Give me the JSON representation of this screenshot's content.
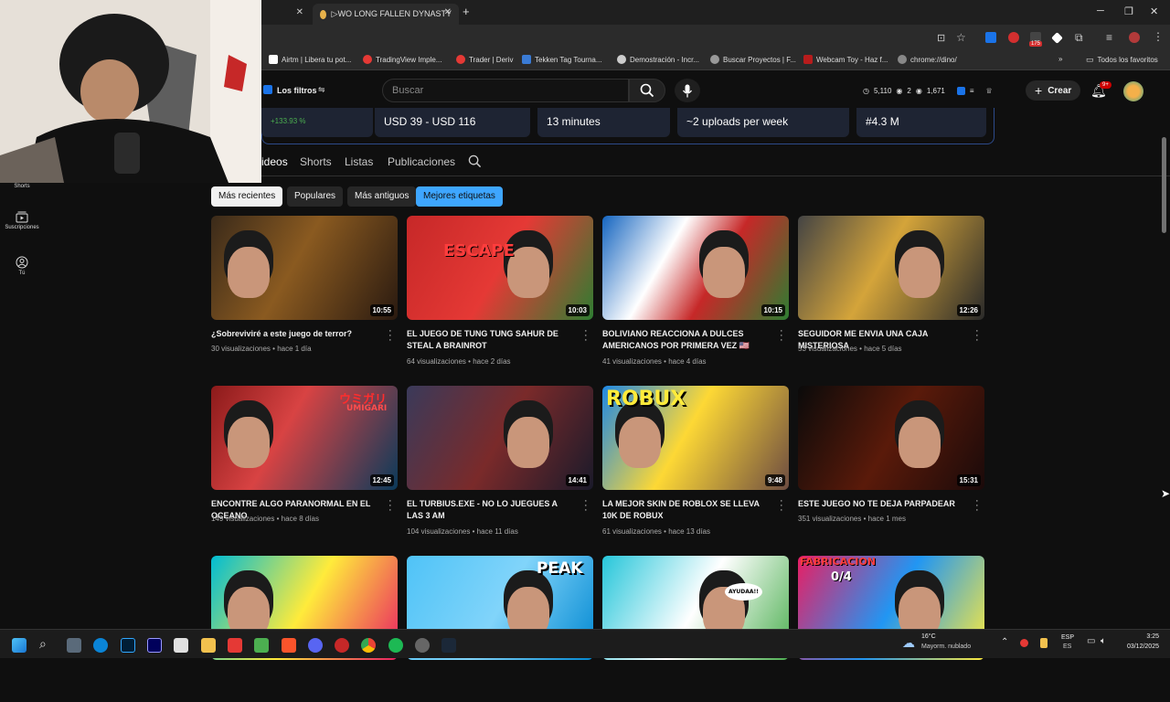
{
  "browser": {
    "tabs": [
      {
        "label": ""
      },
      {
        "label": "▷WO LONG FALLEN DYNASTY"
      }
    ],
    "new_tab": "+",
    "window_controls": [
      "─",
      "❐",
      "✕"
    ],
    "bookmarks": [
      {
        "label": "Airtm | Libera tu pot...",
        "color": "#ffffff"
      },
      {
        "label": "TradingView Imple...",
        "color": "#e53935"
      },
      {
        "label": "Trader | Deriv",
        "color": "#e53935"
      },
      {
        "label": "Tekken Tag Tourna...",
        "color": "#3a7bd5"
      },
      {
        "label": "Demostración - Incr...",
        "color": "#cccccc"
      },
      {
        "label": "Buscar Proyectos | F...",
        "color": "#cccccc"
      },
      {
        "label": "Webcam Toy - Haz f...",
        "color": "#b71c1c"
      },
      {
        "label": "chrome://dino/",
        "color": "#aaaaaa"
      }
    ],
    "all_favorites": "Todos los favoritos",
    "ext_badge": "175"
  },
  "yt": {
    "filters_label": "Los filtros",
    "search_placeholder": "Buscar",
    "stats": {
      "a": "5,110",
      "b": "2",
      "c": "1,671"
    },
    "create_label": "Crear",
    "notif_badge": "9+",
    "stat_cards": [
      {
        "label": "+133.93 %"
      },
      {
        "label": "USD 39 - USD 116"
      },
      {
        "label": "13 minutes"
      },
      {
        "label": "~2 uploads per week"
      },
      {
        "label": "#4.3 M"
      }
    ],
    "channel_tabs": [
      "ideos",
      "Shorts",
      "Listas",
      "Publicaciones"
    ],
    "chips": [
      "Más recientes",
      "Populares",
      "Más antiguos",
      "Mejores etiquetas"
    ],
    "sidebar": [
      {
        "label": "Shorts"
      },
      {
        "label": "Suscripciones"
      },
      {
        "label": "Tú"
      }
    ]
  },
  "videos": [
    {
      "title": "¿Sobreviviré a este juego de terror?",
      "views": "30 visualizaciones",
      "age": "hace 1 día",
      "duration": "10:55"
    },
    {
      "title": "EL JUEGO DE TUNG TUNG SAHUR DE STEAL A BRAINROT",
      "views": "64 visualizaciones",
      "age": "hace 2 días",
      "duration": "10:03",
      "overlay": "ESCAPE"
    },
    {
      "title": "BOLIVIANO REACCIONA A DULCES AMERICANOS POR PRIMERA VEZ 🇺🇸",
      "views": "41 visualizaciones",
      "age": "hace 4 días",
      "duration": "10:15"
    },
    {
      "title": "SEGUIDOR ME ENVIA UNA CAJA MISTERIOSA",
      "views": "53 visualizaciones",
      "age": "hace 5 días",
      "duration": "12:26"
    },
    {
      "title": "ENCONTRE ALGO PARANORMAL EN EL OCEANO",
      "views": "149 visualizaciones",
      "age": "hace 8 días",
      "duration": "12:45",
      "overlay": "ウミガリ",
      "overlay2": "UMIGARI"
    },
    {
      "title": "EL TURBIUS.EXE - NO LO JUEGUES A LAS 3 AM",
      "views": "104 visualizaciones",
      "age": "hace 11 días",
      "duration": "14:41"
    },
    {
      "title": "LA MEJOR SKIN DE ROBLOX SE LLEVA 10K DE ROBUX",
      "views": "61 visualizaciones",
      "age": "hace 13 días",
      "duration": "9:48",
      "overlay": "ROBUX"
    },
    {
      "title": "ESTE JUEGO NO TE DEJA PARPADEAR",
      "views": "351 visualizaciones",
      "age": "hace 1 mes",
      "duration": "15:31"
    },
    {
      "title": "",
      "views": "",
      "age": "",
      "duration": ""
    },
    {
      "title": "",
      "views": "",
      "age": "",
      "duration": "",
      "overlay": "PEAK"
    },
    {
      "title": "",
      "views": "",
      "age": "",
      "duration": "",
      "overlay": "AYUDAA!!"
    },
    {
      "title": "",
      "views": "",
      "age": "",
      "duration": "",
      "overlay": "FABRICACION",
      "overlay2": "0/4"
    }
  ],
  "taskbar": {
    "weather_temp": "16°C",
    "weather_desc": "Mayorm. nublado",
    "lang": "ESP",
    "lang2": "ES",
    "time": "3:25",
    "date": "03/12/2025"
  }
}
